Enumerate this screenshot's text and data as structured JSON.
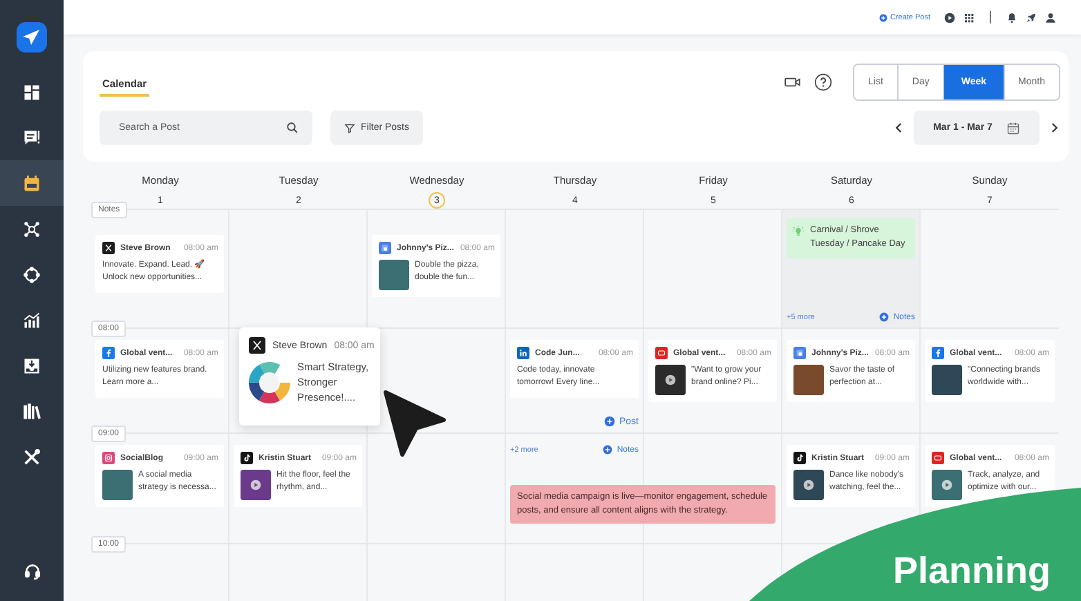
{
  "sidebar": {
    "items": [
      {
        "selected": false
      },
      {
        "selected": false
      },
      {
        "selected": true
      },
      {
        "selected": false
      },
      {
        "selected": false
      },
      {
        "selected": false
      },
      {
        "selected": false
      },
      {
        "selected": false
      },
      {
        "selected": false
      }
    ]
  },
  "topbar": {
    "create_post": "Create Post"
  },
  "header": {
    "tabs": [
      {
        "label": "Calendar",
        "selected": true
      }
    ],
    "views": [
      {
        "label": "List",
        "selected": false
      },
      {
        "label": "Day",
        "selected": false
      },
      {
        "label": "Week",
        "selected": true
      },
      {
        "label": "Month",
        "selected": false
      }
    ],
    "search": {
      "placeholder": "Search a Post"
    },
    "filter": "Filter Posts",
    "date_range": "Mar 1 - Mar 7"
  },
  "days": [
    {
      "name": "Monday",
      "number": "1",
      "today": false
    },
    {
      "name": "Tuesday",
      "number": "2",
      "today": false
    },
    {
      "name": "Wednesday",
      "number": "3",
      "today": true
    },
    {
      "name": "Thursday",
      "number": "4",
      "today": false
    },
    {
      "name": "Friday",
      "number": "5",
      "today": false
    },
    {
      "name": "Saturday",
      "number": "6",
      "today": false
    },
    {
      "name": "Sunday",
      "number": "7",
      "today": false
    }
  ],
  "rows": [
    {
      "kind": "notes",
      "label": "Notes",
      "cells": [
        {
          "posts": [
            {
              "kind": "x",
              "author": "Steve Brown",
              "time": "08:00 am",
              "text": "Innovate. Expand. Lead. 🚀 Unlock new opportunities...",
              "has_image": false
            }
          ]
        },
        {},
        {
          "posts": [
            {
              "kind": "google",
              "author": "Johnny's Piz...",
              "time": "08:00 am",
              "text": "Double the pizza, double the fun...",
              "has_image": true,
              "video": false
            }
          ]
        },
        {},
        {},
        {
          "note": "Carnival / Shrove Tuesday / Pancake Day",
          "more": "+5 more",
          "add": "Notes"
        },
        {}
      ]
    },
    {
      "kind": "time",
      "label": "08:00",
      "cells": [
        {
          "posts": [
            {
              "kind": "facebook",
              "author": "Global vent...",
              "time": "08:00 am",
              "text": "Utilizing new features brand. Learn more a...",
              "has_image": false
            }
          ]
        },
        {},
        {},
        {
          "posts": [
            {
              "kind": "linkedin",
              "author": "Code Jun...",
              "time": "08:00 am",
              "text": "Code today, innovate tomorrow! Every line...",
              "has_image": false
            }
          ],
          "add": "Post"
        },
        {
          "posts": [
            {
              "kind": "youtube",
              "author": "Global vent...",
              "time": "08:00 am",
              "text": "\"Want to grow your brand online? Pi...",
              "has_image": true,
              "video": true
            }
          ]
        },
        {
          "posts": [
            {
              "kind": "google",
              "author": "Johnny's Piz...",
              "time": "08:00 am",
              "text": "Savor the taste of perfection at...",
              "has_image": true,
              "video": false
            }
          ]
        },
        {
          "posts": [
            {
              "kind": "facebook",
              "author": "Global vent...",
              "time": "08:00 am",
              "text": "\"Connecting brands worldwide with...",
              "has_image": true,
              "video": false
            }
          ]
        }
      ]
    },
    {
      "kind": "time",
      "label": "09:00",
      "cells": [
        {
          "posts": [
            {
              "kind": "instagram",
              "author": "SocialBlog",
              "time": "09:00 am",
              "text": "A social media strategy is necessa...",
              "has_image": true,
              "video": false
            }
          ]
        },
        {
          "posts": [
            {
              "kind": "tiktok",
              "author": "Kristin Stuart",
              "time": "09:00 am",
              "text": "Hit the floor, feel the rhythm, and...",
              "has_image": true,
              "video": true
            }
          ]
        },
        {},
        {
          "more": "+2 more",
          "add": "Notes",
          "banner": "Social media campaign is live—monitor engagement, schedule posts, and ensure all content aligns with the strategy."
        },
        {},
        {
          "posts": [
            {
              "kind": "tiktok",
              "author": "Kristin Stuart",
              "time": "09:00 am",
              "text": "Dance like nobody's watching, feel the...",
              "has_image": true,
              "video": true
            }
          ]
        },
        {
          "posts": [
            {
              "kind": "youtube",
              "author": "Global vent...",
              "time": "08:00 am",
              "text": "Track, analyze, and optimize with our...",
              "has_image": true,
              "video": true
            }
          ]
        }
      ]
    },
    {
      "kind": "time",
      "label": "10:00",
      "cells": [
        {},
        {},
        {},
        {},
        {},
        {},
        {}
      ]
    }
  ],
  "popup": {
    "kind": "x",
    "author": "Steve Brown",
    "time": "08:00 am",
    "text": "Smart Strategy, Stronger Presence!...."
  },
  "banner": {
    "title": "Planning"
  }
}
